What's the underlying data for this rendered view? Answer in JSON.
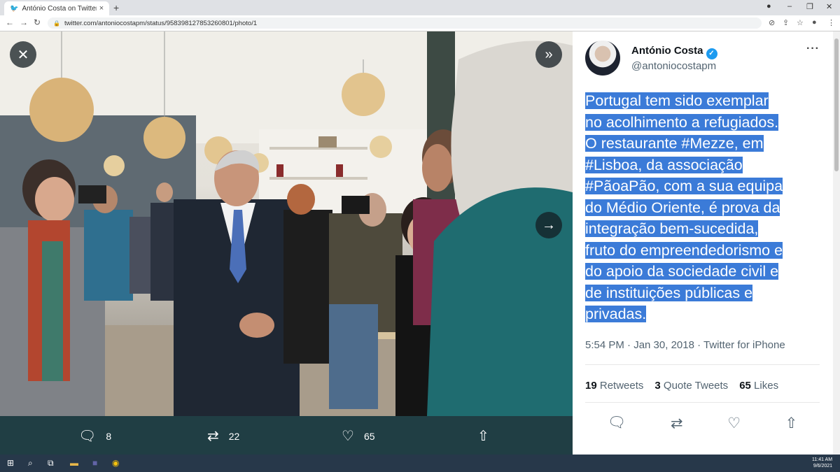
{
  "browser": {
    "tab_title": "António Costa on Twitter: \"Portu",
    "tab_close": "×",
    "new_tab": "+",
    "url": "twitter.com/antoniocostapm/status/958398127853260801/photo/1"
  },
  "viewer": {
    "close_glyph": "✕",
    "expand_glyph": "»",
    "next_glyph": "→",
    "actions": {
      "replies": "8",
      "retweets": "22",
      "likes": "65"
    }
  },
  "tweet": {
    "name": "António Costa",
    "verified_glyph": "✓",
    "handle": "@antoniocostapm",
    "more": "···",
    "text_lines": [
      "Portugal tem sido exemplar",
      "no acolhimento a refugiados.",
      "O restaurante #Mezze, em",
      "#Lisboa, da associação",
      "#PãoaPão, com a sua equipa",
      "do Médio Oriente, é prova da",
      "integração bem-sucedida,",
      "fruto do empreendedorismo e",
      "do apoio da sociedade civil e",
      "de instituições públicas e",
      "privadas."
    ],
    "meta": "5:54 PM · Jan 30, 2018 · Twitter for iPhone",
    "stats": {
      "retweets_count": "19",
      "retweets_label": "Retweets",
      "quotes_count": "3",
      "quotes_label": "Quote Tweets",
      "likes_count": "65",
      "likes_label": "Likes"
    }
  },
  "taskbar": {
    "time": "11:41 AM",
    "date": "9/6/2021"
  },
  "colors": {
    "selection": "#3b7bd8",
    "twitter_blue": "#1d9bf0",
    "viewer_bg": "#203e44"
  }
}
